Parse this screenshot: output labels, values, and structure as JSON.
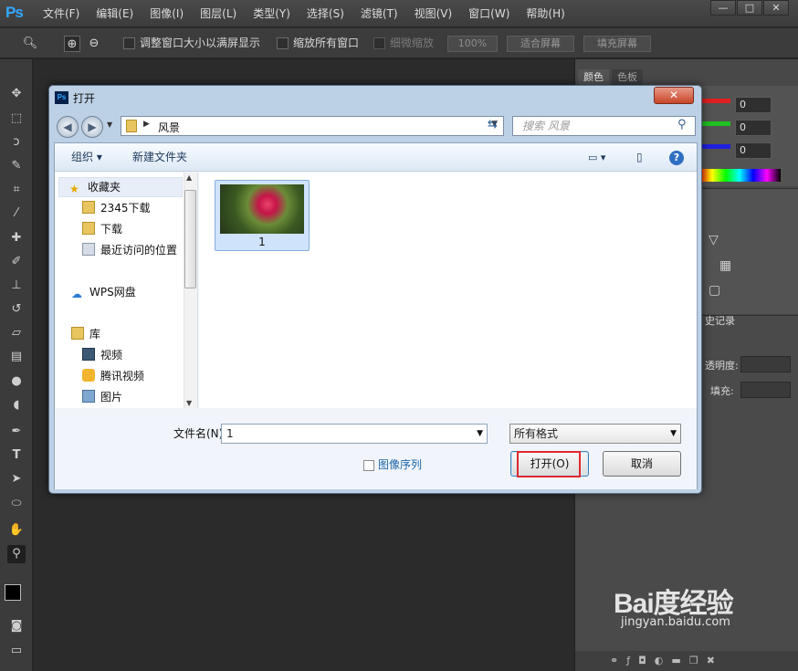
{
  "app": {
    "logo": "Ps"
  },
  "menubar": {
    "items": [
      "文件(F)",
      "编辑(E)",
      "图像(I)",
      "图层(L)",
      "类型(Y)",
      "选择(S)",
      "滤镜(T)",
      "视图(V)",
      "窗口(W)",
      "帮助(H)"
    ]
  },
  "window_controls": {
    "minimize": "—",
    "maximize": "□",
    "close": "✕"
  },
  "options_bar": {
    "resize_windows_label": "调整窗口大小以满屏显示",
    "zoom_all_label": "缩放所有窗口",
    "scrubby_label": "细微缩放",
    "zoom_value": "100%",
    "fit_screen_label": "适合屏幕",
    "fill_screen_label": "填充屏幕"
  },
  "right_panel": {
    "tabs": [
      "颜色",
      "色板"
    ],
    "rgb_values": [
      "0",
      "0",
      "0"
    ],
    "history_label": "史记录",
    "opacity_label": "透明度:",
    "fill_label": "填充:"
  },
  "dialog": {
    "title": "打开",
    "close_label": "✕",
    "address_path": "风景",
    "search_placeholder": "搜索 风景",
    "organize_label": "组织 ▾",
    "new_folder_label": "新建文件夹",
    "nav": {
      "favorites": "收藏夹",
      "items": [
        "2345下载",
        "下载",
        "最近访问的位置"
      ],
      "wps": "WPS网盘",
      "library": "库",
      "library_items": [
        "视频",
        "腾讯视频",
        "图片"
      ]
    },
    "files": [
      {
        "name": "1"
      }
    ],
    "filename_label": "文件名(N):",
    "filename_value": "1",
    "filetype_value": "所有格式",
    "image_sequence_label": "图像序列",
    "open_label": "打开(O)",
    "cancel_label": "取消"
  },
  "watermark": {
    "logo": "Bai度经验",
    "url": "jingyan.baidu.com"
  },
  "colors": {
    "ps_blue": "#31a8ff",
    "highlight_red": "#e0272e",
    "dialog_frame": "#bcd0e6"
  }
}
